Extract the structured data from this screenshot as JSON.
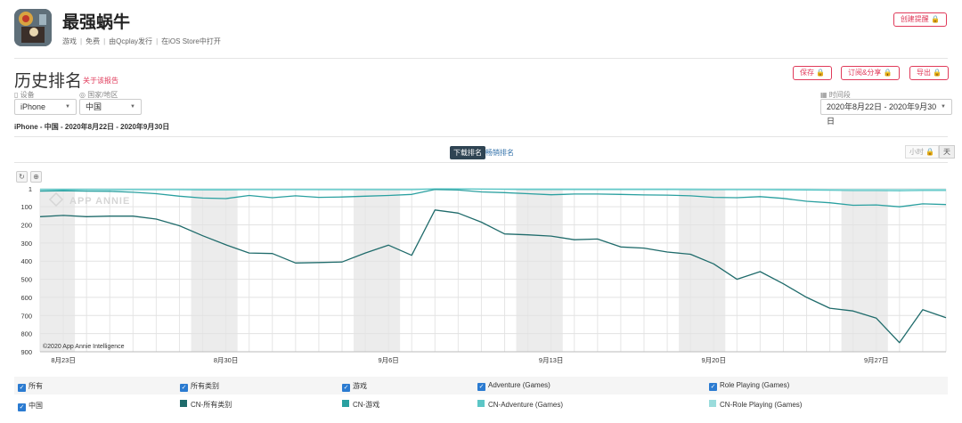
{
  "app": {
    "title": "最强蜗牛",
    "meta": [
      "游戏",
      "免费",
      "由Qcplay发行",
      "在iOS Store中打开"
    ],
    "create_alert": "创建提醒 🔒"
  },
  "section": {
    "title": "历史排名",
    "about_link": "关于该报告",
    "save": "保存 🔒",
    "subscribe": "订阅&分享 🔒",
    "export": "导出 🔒"
  },
  "filters": {
    "device_label": "▯ 设备",
    "device_value": "iPhone",
    "country_label": "◎ 国家/地区",
    "country_value": "中国",
    "period_label": "▦ 时间段",
    "period_value": "2020年8月22日 - 2020年9月30日"
  },
  "subtitle": "iPhone - 中国 - 2020年8月22日 - 2020年9月30日",
  "tabs": {
    "downloads": "下载排名",
    "revenue": "畅销排名"
  },
  "granularity": {
    "hour": "小时 🔒",
    "day": "天"
  },
  "tools": {
    "reset": "↻",
    "zoom": "⊕"
  },
  "watermark": "APP ANNIE",
  "copyright": "©2020 App Annie Intelligence",
  "chart_data": {
    "type": "line",
    "y_axis": {
      "inverted": true,
      "ticks": [
        "1",
        "100",
        "200",
        "300",
        "400",
        "500",
        "600",
        "700",
        "800",
        "900"
      ],
      "ylim": [
        1,
        900
      ]
    },
    "x_ticks": [
      "8月23日",
      "8月30日",
      "9月6日",
      "9月13日",
      "9月20日",
      "9月27日"
    ],
    "dates": [
      "8/22",
      "8/23",
      "8/24",
      "8/25",
      "8/26",
      "8/27",
      "8/28",
      "8/29",
      "8/30",
      "8/31",
      "9/1",
      "9/2",
      "9/3",
      "9/4",
      "9/5",
      "9/6",
      "9/7",
      "9/8",
      "9/9",
      "9/10",
      "9/11",
      "9/12",
      "9/13",
      "9/14",
      "9/15",
      "9/16",
      "9/17",
      "9/18",
      "9/19",
      "9/20",
      "9/21",
      "9/22",
      "9/23",
      "9/24",
      "9/25",
      "9/26",
      "9/27",
      "9/28",
      "9/29",
      "9/30"
    ],
    "weekends": [
      [
        "8/22",
        "8/23"
      ],
      [
        "8/29",
        "8/30"
      ],
      [
        "9/5",
        "9/6"
      ],
      [
        "9/12",
        "9/13"
      ],
      [
        "9/19",
        "9/20"
      ],
      [
        "9/26",
        "9/27"
      ]
    ],
    "series": [
      {
        "name": "CN-所有类别",
        "color": "#1f6b6b",
        "values": [
          155,
          148,
          155,
          152,
          152,
          168,
          205,
          260,
          310,
          355,
          358,
          410,
          408,
          405,
          355,
          312,
          368,
          118,
          135,
          185,
          250,
          255,
          262,
          282,
          278,
          322,
          328,
          350,
          362,
          415,
          500,
          458,
          525,
          600,
          660,
          675,
          715,
          850,
          668,
          712
        ]
      },
      {
        "name": "CN-游戏",
        "color": "#2aa0a0",
        "values": [
          14,
          12,
          14,
          15,
          20,
          28,
          42,
          52,
          55,
          38,
          50,
          40,
          48,
          46,
          42,
          38,
          32,
          5,
          8,
          18,
          22,
          28,
          34,
          30,
          30,
          32,
          35,
          36,
          40,
          48,
          50,
          44,
          54,
          70,
          78,
          92,
          90,
          100,
          84,
          88
        ]
      },
      {
        "name": "CN-Adventure (Games)",
        "color": "#5cc6c6",
        "values": [
          6,
          5,
          5,
          6,
          6,
          6,
          6,
          7,
          7,
          6,
          6,
          6,
          6,
          6,
          6,
          6,
          6,
          2,
          2,
          3,
          4,
          5,
          5,
          5,
          5,
          5,
          5,
          5,
          6,
          6,
          6,
          6,
          7,
          8,
          9,
          11,
          11,
          12,
          10,
          10
        ]
      },
      {
        "name": "CN-Role Playing (Games)",
        "color": "#9adcdc",
        "values": [
          3,
          3,
          3,
          3,
          3,
          3,
          3,
          3,
          3,
          3,
          3,
          3,
          3,
          3,
          3,
          3,
          3,
          1,
          1,
          2,
          2,
          2,
          2,
          2,
          2,
          2,
          2,
          2,
          2,
          3,
          3,
          3,
          3,
          3,
          4,
          4,
          4,
          4,
          4,
          4
        ]
      }
    ]
  },
  "legend": {
    "row1": [
      {
        "label": "所有",
        "checked": true
      },
      {
        "label": "所有类别",
        "checked": true
      },
      {
        "label": "游戏",
        "checked": true
      },
      {
        "label": "Adventure (Games)",
        "checked": true
      },
      {
        "label": "Role Playing (Games)",
        "checked": true
      }
    ],
    "row2": [
      {
        "label": "中国",
        "checked": true
      },
      {
        "label": "CN-所有类别",
        "color": "#1f6b6b"
      },
      {
        "label": "CN-游戏",
        "color": "#2aa0a0"
      },
      {
        "label": "CN-Adventure (Games)",
        "color": "#5cc6c6"
      },
      {
        "label": "CN-Role Playing (Games)",
        "color": "#9adcdc"
      }
    ]
  }
}
